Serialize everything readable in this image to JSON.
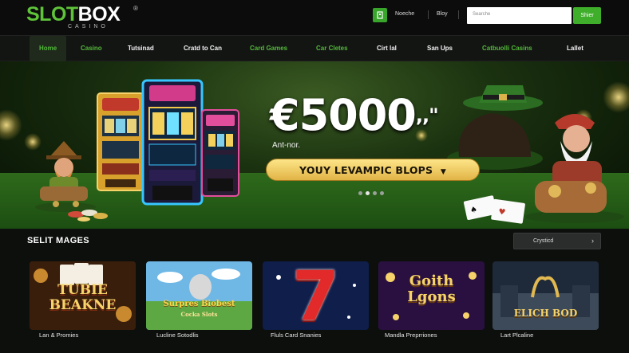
{
  "brand": {
    "name_green": "SLOT",
    "name_white": "BOX",
    "reg": "®",
    "tagline": "CASINO"
  },
  "header": {
    "links": [
      "Noeche",
      "Bloy"
    ],
    "search_placeholder": "Searche",
    "search_button": "Shier",
    "accent_color": "#3fae2b"
  },
  "nav": {
    "items": [
      {
        "label": "Home",
        "style": "active"
      },
      {
        "label": "Casino",
        "style": "green"
      },
      {
        "label": "Tutsinad",
        "style": "white"
      },
      {
        "label": "Cratd to Can",
        "style": "white"
      },
      {
        "label": "Card Games",
        "style": "green"
      },
      {
        "label": "Car Cletes",
        "style": "green"
      },
      {
        "label": "Cirt lal",
        "style": "white"
      },
      {
        "label": "San Ups",
        "style": "white"
      },
      {
        "label": "Catbuolli Casins",
        "style": "green"
      },
      {
        "label": "Lallet",
        "style": "white"
      }
    ]
  },
  "hero": {
    "amount": "€5000",
    "amount_suffix": ",,\"",
    "subtitle": "Ant-nor.",
    "cta": "YOUY LEVAMPIC BLOPS",
    "cta_icon": "caret-down-icon",
    "slides_total": 4,
    "slide_active": 2
  },
  "section": {
    "title": "SELIT MAGES",
    "sort": "Crysticd",
    "sort_icon": "chevron-right-icon"
  },
  "games": [
    {
      "art_title_1": "TUBIE",
      "art_title_2": "BEAKNE",
      "label": "Lan & Promies",
      "theme": "cards"
    },
    {
      "art_title_1": "Surpres Biobest",
      "art_title_2": "Cocka Slots",
      "label": "Lucline Sotodlis",
      "theme": "sky"
    },
    {
      "art_title_1": "7",
      "art_title_2": "",
      "label": "Fluls Card Snanies",
      "theme": "seven"
    },
    {
      "art_title_1": "Goith",
      "art_title_2": "Lgons",
      "label": "Mandla Preprriones",
      "theme": "gold"
    },
    {
      "art_title_1": "ELICH BOD",
      "art_title_2": "",
      "label": "Lart Plcaline",
      "theme": "palace"
    }
  ]
}
